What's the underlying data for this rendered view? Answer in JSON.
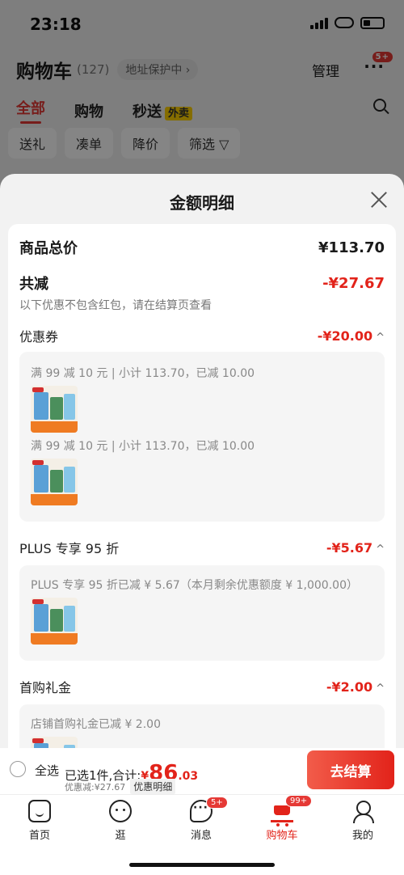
{
  "status_bar": {
    "time": "23:18"
  },
  "cart": {
    "title": "购物车",
    "count": "(127)",
    "address_label": "地址保护中 ›",
    "manage": "管理",
    "more": "···",
    "more_badge": "5+",
    "tabs": [
      "全部",
      "购物",
      "秒送"
    ],
    "takeout_tag": "外卖",
    "filters": [
      "送礼",
      "凑单",
      "降价",
      "筛选 ▽"
    ]
  },
  "sheet": {
    "title": "金额明细",
    "total_label": "商品总价",
    "total_value": "¥113.70",
    "discount_label": "共减",
    "discount_value": "-¥27.67",
    "discount_note": "以下优惠不包含红包，请在结算页查看",
    "sections": [
      {
        "label": "优惠券",
        "value": "-¥20.00",
        "caret": "^",
        "rules": [
          "满 99 减 10 元 | 小计 113.70，已减 10.00",
          "满 99 减 10 元 | 小计 113.70，已减 10.00"
        ]
      },
      {
        "label": "PLUS 专享 95 折",
        "value": "-¥5.67",
        "caret": "^",
        "rules": [
          "PLUS 专享 95 折已减 ¥ 5.67（本月剩余优惠额度 ¥ 1,000.00）"
        ]
      },
      {
        "label": "首购礼金",
        "value": "-¥2.00",
        "caret": "^",
        "rules": [
          "店铺首购礼金已减 ¥ 2.00"
        ]
      }
    ]
  },
  "checkout": {
    "select_all": "全选",
    "selected_info": "已选1件,合计:",
    "currency": "¥",
    "price_int": "86",
    "price_dec": ".03",
    "discount_text": "优惠减:¥27.67",
    "detail_button": "优惠明细",
    "checkout_button": "去结算"
  },
  "tabbar": {
    "items": [
      {
        "label": "首页"
      },
      {
        "label": "逛"
      },
      {
        "label": "消息",
        "badge": "5+"
      },
      {
        "label": "购物车",
        "badge": "99+"
      },
      {
        "label": "我的"
      }
    ]
  },
  "colors": {
    "accent": "#e2231a",
    "sheet_bg": "#f2f2f2"
  }
}
